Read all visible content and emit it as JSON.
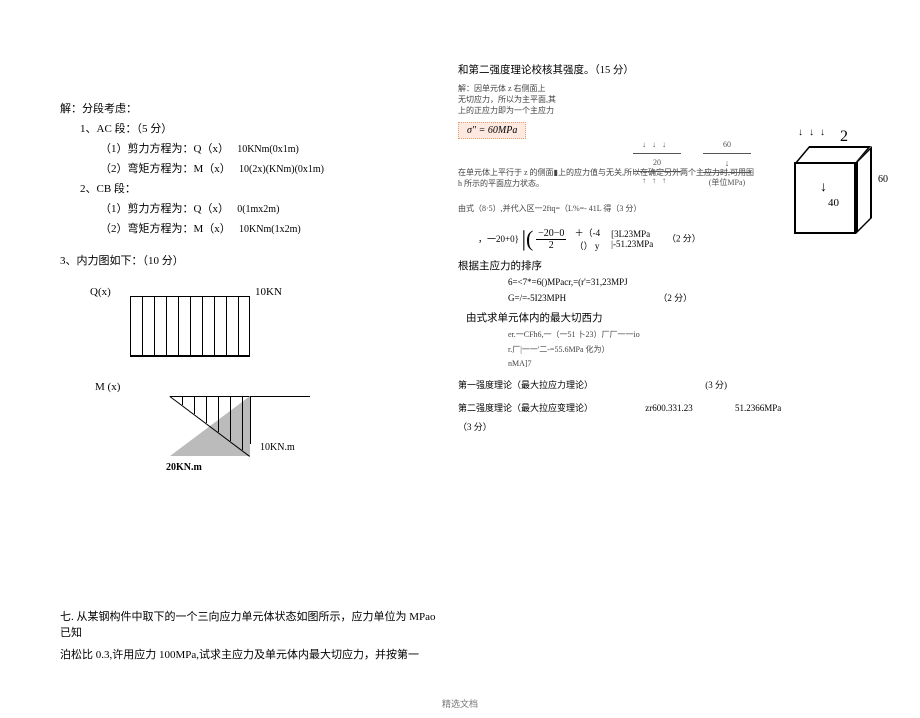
{
  "left": {
    "intro": "解：分段考虑：",
    "sec1": {
      "title": "1、AC 段：（5 分）",
      "q_label": "（1）剪力方程为：Q（x）",
      "q_expr": "10KNm(0x1m)",
      "m_label": "（2）弯矩方程为：M（x）",
      "m_expr": "10(2x)(KNm)(0x1m)"
    },
    "sec2": {
      "title": "2、CB 段：",
      "q_label": "（1）剪力方程为：Q（x）",
      "q_expr": "0(1mx2m)",
      "m_label": "（2）弯矩方程为：M（x）",
      "m_expr": "10KNm(1x2m)"
    },
    "diag_title": "3、内力图如下：（10 分）",
    "qx": "Q(x)",
    "tenkn": "10KN",
    "mx": "M (x)",
    "tenknm": "10KN.m",
    "twentyknm": "20KN.m",
    "problem7_a": "七. 从某钢构件中取下的一个三向应力单元体状态如图所示，应力单位为 MPao 已知",
    "problem7_b": "泊松比 0.3,许用应力 100MPa,试求主应力及单元体内最大切应力，并按第一"
  },
  "right": {
    "heading": "和第二强度理论校核其强度。（15 分）",
    "para1a": "解：因单元体 z 右侧面上",
    "para1b": "无切应力，所以为主平面,其",
    "para1c": "上的正应力即为一个主应力",
    "sigma": "σ\" = 60MPa",
    "mini1": "20",
    "mini2": "60",
    "mini3": "(单位MPa)",
    "para2": "在单元体上平行于 z 的侧面▮上的应力值与无关,所以在确定另外两个主应力时,可用图 h 所示的平面应力状态。",
    "para3": "由式（8·5）,并代入区一2ftq=（L%=- 41L 得（3 分）",
    "frac_pre": "，一20+0}",
    "frac_num": "−20−0",
    "frac_den": "2",
    "frac_mid": "＋（-4",
    "frac_y": "（） y",
    "brkA": "[3L23MPa",
    "brkB": "|-51.23MPa",
    "score2": "（2 分）",
    "sort_title": "根据主应力的排序",
    "sortA": "6=<7*=6()MPacr,=(r'=31,23MPJ",
    "sortB": "G=/=-5I23MPH",
    "score2b": "（2 分）",
    "tau_title": "由式求单元体内的最大切西力",
    "tauA": "er.一CFh6,一（一51 卜23）厂厂一一io",
    "tauB": "r.厂|一一'二-=55.6MPa 化为）",
    "tauC": "nMA]7",
    "th1": "第一强度理论（最大拉应力理论）",
    "th1_score": "(3 分)",
    "th2": "第二强度理论（最大拉应变理论）",
    "th2_val": "zr600.331.23",
    "th2_mpa": "51.2366MPa",
    "th2_score": "（3 分）",
    "cube": {
      "top2": "2",
      "forty": "40",
      "sixty": "60",
      "arrows": "↓↓↓"
    }
  },
  "footer": "精选文档"
}
